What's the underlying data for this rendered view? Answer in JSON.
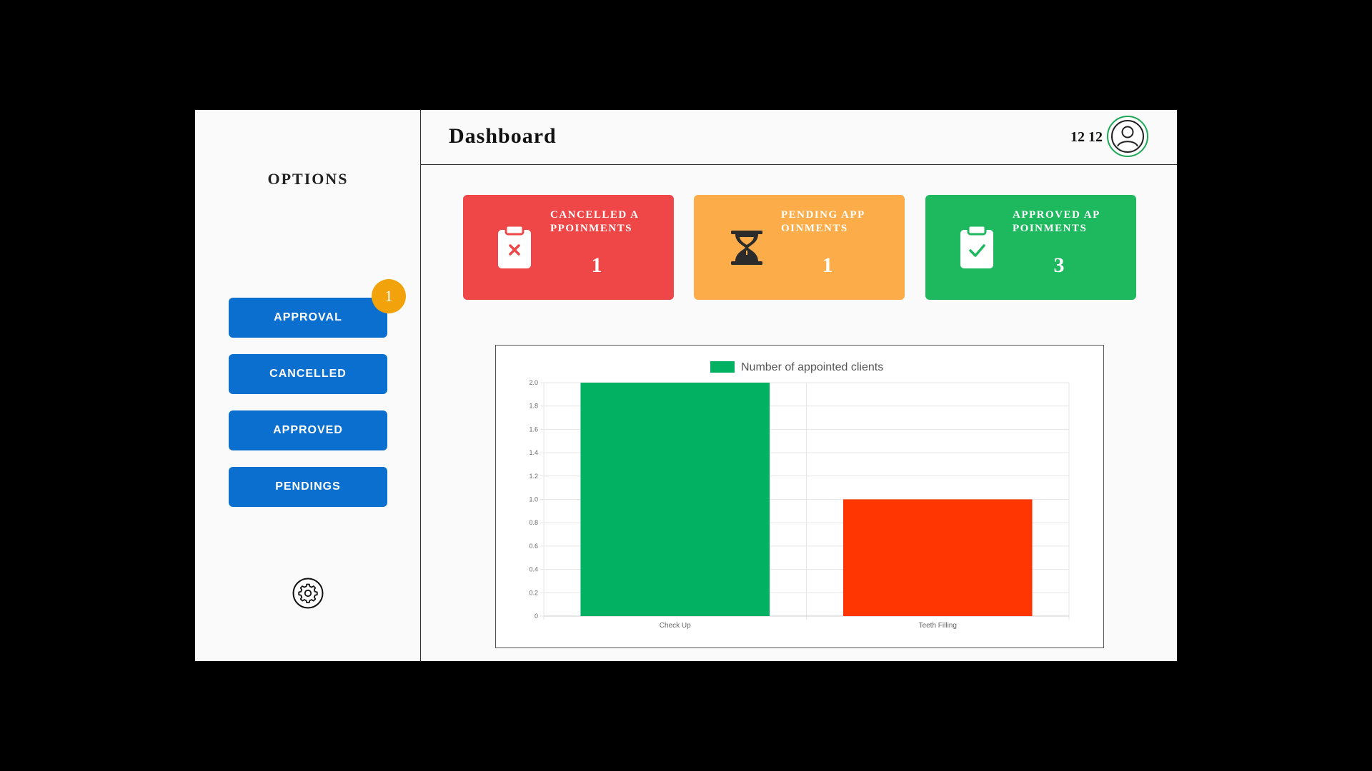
{
  "sidebar": {
    "title": "OPTIONS",
    "items": [
      {
        "label": "APPROVAL",
        "badge": "1"
      },
      {
        "label": "CANCELLED"
      },
      {
        "label": "APPROVED"
      },
      {
        "label": "PENDINGS"
      }
    ],
    "settings_icon": "gear-icon"
  },
  "header": {
    "title": "Dashboard",
    "user_label": "12 12",
    "avatar_icon": "user-icon"
  },
  "cards": [
    {
      "label": "CANCELLED APPOINMENTS",
      "value": "1",
      "color": "#ef4747",
      "icon": "clipboard-x-icon"
    },
    {
      "label": "PENDING APPOINMENTS",
      "value": "1",
      "color": "#fcac48",
      "icon": "hourglass-icon"
    },
    {
      "label": "APPROVED APPOINMENTS",
      "value": "3",
      "color": "#1eb85e",
      "icon": "clipboard-check-icon"
    }
  ],
  "colors": {
    "nav_button": "#0b6fd0",
    "badge": "#f2a20a",
    "bar_check_up": "#02b262",
    "bar_teeth_filling": "#ff3601"
  },
  "chart_data": {
    "type": "bar",
    "categories": [
      "Check Up",
      "Teeth Filling"
    ],
    "series": [
      {
        "name": "Number of appointed clients",
        "values": [
          2,
          1
        ],
        "colors": [
          "#02b262",
          "#ff3601"
        ]
      }
    ],
    "ylim": [
      0,
      2.0
    ],
    "yticks": [
      "0",
      "0.2",
      "0.4",
      "0.6",
      "0.8",
      "1.0",
      "1.2",
      "1.4",
      "1.6",
      "1.8",
      "2.0"
    ],
    "legend": "top-center",
    "grid": true
  }
}
